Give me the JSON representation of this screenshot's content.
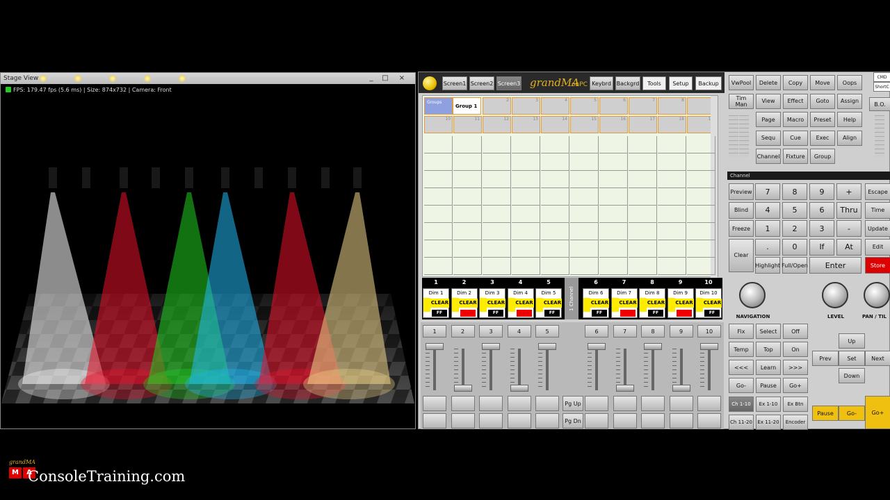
{
  "stage_window": {
    "title": "Stage View",
    "status": "FPS: 179.47 fps (5.6 ms) | Size: 874x732 | Camera: Front",
    "minimize": "_",
    "maximize": "□",
    "close": "×",
    "logo_text": "MA",
    "logo_sub": "grandMA",
    "spot_colors": [
      "#ffffff",
      "#e8102a",
      "#20d020",
      "#20b8f0",
      "#e8102a",
      "#f2d68a"
    ]
  },
  "console": {
    "brand": "grandMA",
    "brand_sub": "onPC",
    "screen_tabs": [
      "Screen1",
      "Screen2",
      "Screen3"
    ],
    "top_buttons": [
      "Keybrd",
      "Backgrd",
      "Tools",
      "Setup",
      "Backup"
    ],
    "pool": {
      "groups_label": "Groups",
      "group1_label": "Group 1",
      "row1_numbers": [
        "1",
        "2",
        "3",
        "4",
        "5",
        "6",
        "7",
        "8",
        "9"
      ],
      "row2_numbers": [
        "10",
        "11",
        "12",
        "13",
        "14",
        "15",
        "16",
        "17",
        "18",
        "19"
      ]
    },
    "executors_left": [
      {
        "num": "1",
        "name": "Dim 1",
        "clear": "CLEAR",
        "ff": "FF",
        "red": false
      },
      {
        "num": "2",
        "name": "Dim 2",
        "clear": "CLEAR",
        "ff": "",
        "red": true
      },
      {
        "num": "3",
        "name": "Dim 3",
        "clear": "CLEAR",
        "ff": "FF",
        "red": false
      },
      {
        "num": "4",
        "name": "Dim 4",
        "clear": "CLEAR",
        "ff": "",
        "red": true
      },
      {
        "num": "5",
        "name": "Dim 5",
        "clear": "CLEAR",
        "ff": "FF",
        "red": false
      }
    ],
    "executors_right": [
      {
        "num": "6",
        "name": "Dim 6",
        "clear": "CLEAR",
        "ff": "FF",
        "red": false
      },
      {
        "num": "7",
        "name": "Dim 7",
        "clear": "CLEAR",
        "ff": "",
        "red": true
      },
      {
        "num": "8",
        "name": "Dim 8",
        "clear": "CLEAR",
        "ff": "FF",
        "red": false
      },
      {
        "num": "9",
        "name": "Dim 9",
        "clear": "CLEAR",
        "ff": "",
        "red": true
      },
      {
        "num": "10",
        "name": "Dim 10",
        "clear": "CLEAR",
        "ff": "FF",
        "red": false
      }
    ],
    "channel_tab": "1 Channel",
    "fader_numbers": [
      "1",
      "2",
      "3",
      "4",
      "5",
      "6",
      "7",
      "8",
      "9",
      "10"
    ],
    "page_buttons": [
      "Pg Up",
      "Pg Dn"
    ],
    "right_top_grid": [
      [
        "VwPool",
        "Delete",
        "Copy",
        "Move",
        "Oops"
      ],
      [
        "Tim Man",
        "View",
        "Effect",
        "Goto",
        "Assign"
      ],
      [
        "",
        "Page",
        "Macro",
        "Preset",
        "Help"
      ],
      [
        "",
        "Sequ",
        "Cue",
        "Exec",
        "Align"
      ],
      [
        "",
        "Channel",
        "Fixture",
        "Group",
        ""
      ]
    ],
    "far_right_labels": [
      "CMD",
      "ShortC",
      "B.O."
    ],
    "cmd_label": "Channel",
    "keypad_left": [
      "Preview",
      "Blind",
      "Freeze",
      "Clear"
    ],
    "keypad": [
      [
        "7",
        "8",
        "9",
        "+"
      ],
      [
        "4",
        "5",
        "6",
        "Thru"
      ],
      [
        "1",
        "2",
        "3",
        "-"
      ],
      [
        ".",
        "0",
        "If",
        "At"
      ]
    ],
    "keypad_right": [
      "Escape",
      "Time",
      "Update",
      "Edit",
      "Store"
    ],
    "highlight": "Highlight",
    "fullopen": "Full/Open",
    "enter": "Enter",
    "knobs": [
      "NAVIGATION",
      "LEVEL",
      "PAN / TIL"
    ],
    "lower_grid": [
      [
        "Fix",
        "Select",
        "Off"
      ],
      [
        "Temp",
        "Top",
        "On"
      ],
      [
        "<<<",
        "Learn",
        ">>>"
      ],
      [
        "Go-",
        "Pause",
        "Go+"
      ]
    ],
    "bank_buttons": [
      [
        "Ch 1-10",
        "Ex 1-10",
        "Ex Btn"
      ],
      [
        "Ch 11-20",
        "Ex 11-20",
        "Encoder"
      ]
    ],
    "nav_pad": {
      "up": "Up",
      "prev": "Prev",
      "set": "Set",
      "next": "Next",
      "down": "Down"
    },
    "playback": [
      "Pause",
      "Go-",
      "Go+"
    ]
  },
  "footer": "ConsoleTraining.com"
}
